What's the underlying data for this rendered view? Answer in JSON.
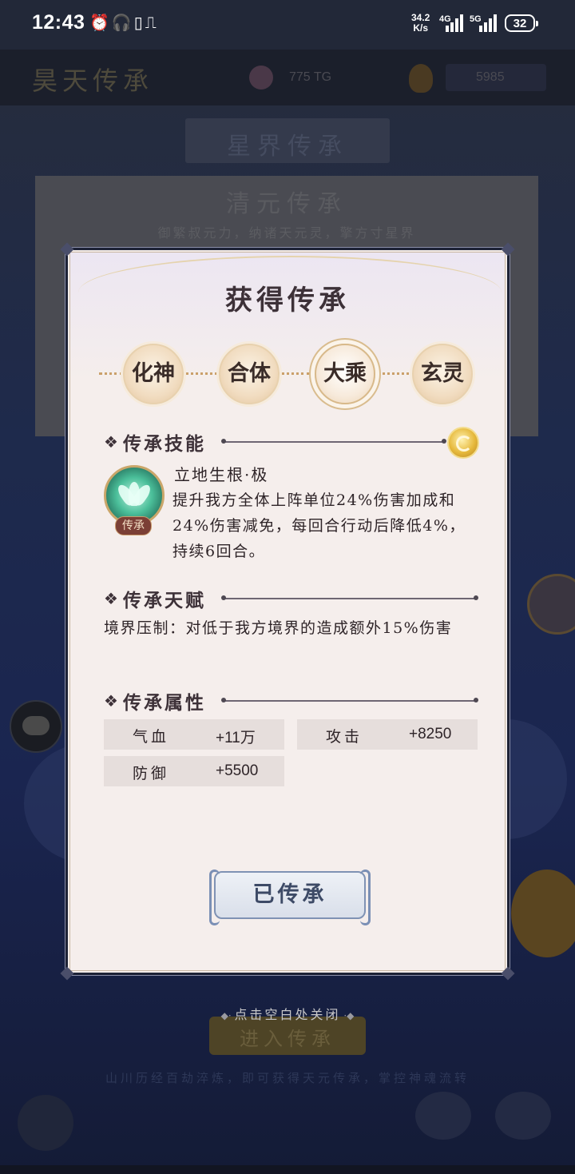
{
  "status_bar": {
    "time": "12:43",
    "icons": "⏰🎧▯⎍",
    "speed_top": "34.2",
    "speed_bottom": "K/s",
    "net1": "4G",
    "net2": "5G",
    "battery": "32"
  },
  "background": {
    "title": "昊天传承",
    "res1": "775 TG",
    "res2": "5985",
    "banner": "星界传承",
    "card_title": "清元传承",
    "card_subtitle": "御繁叔元力，纳诸天元灵，擎方寸星界",
    "enter": "进入传承",
    "footer": "山川历经百劫淬炼，即可获得天元传承，掌控神魂流转"
  },
  "modal": {
    "title": "获得传承",
    "stages": [
      "化神",
      "合体",
      "大乘",
      "玄灵"
    ],
    "active_stage": "大乘",
    "skill_section": "传承技能",
    "skill_badge": "传承",
    "skill_name": "立地生根·极",
    "skill_desc": "提升我方全体上阵单位24%伤害加成和24%伤害减免，每回合行动后降低4%，持续6回合。",
    "talent_section": "传承天赋",
    "talent_text": "境界压制：对低于我方境界的造成额外15%伤害",
    "attr_section": "传承属性",
    "attributes": [
      {
        "name": "气血",
        "value": "+11万"
      },
      {
        "name": "攻击",
        "value": "+8250"
      },
      {
        "name": "防御",
        "value": "+5500"
      }
    ],
    "button": "已传承"
  },
  "close_hint": "点击空白处关闭",
  "colors": {
    "modal_bg": "#f4edea",
    "frame": "#1d2236",
    "text": "#2e2428",
    "button_border": "#7f92b4"
  }
}
